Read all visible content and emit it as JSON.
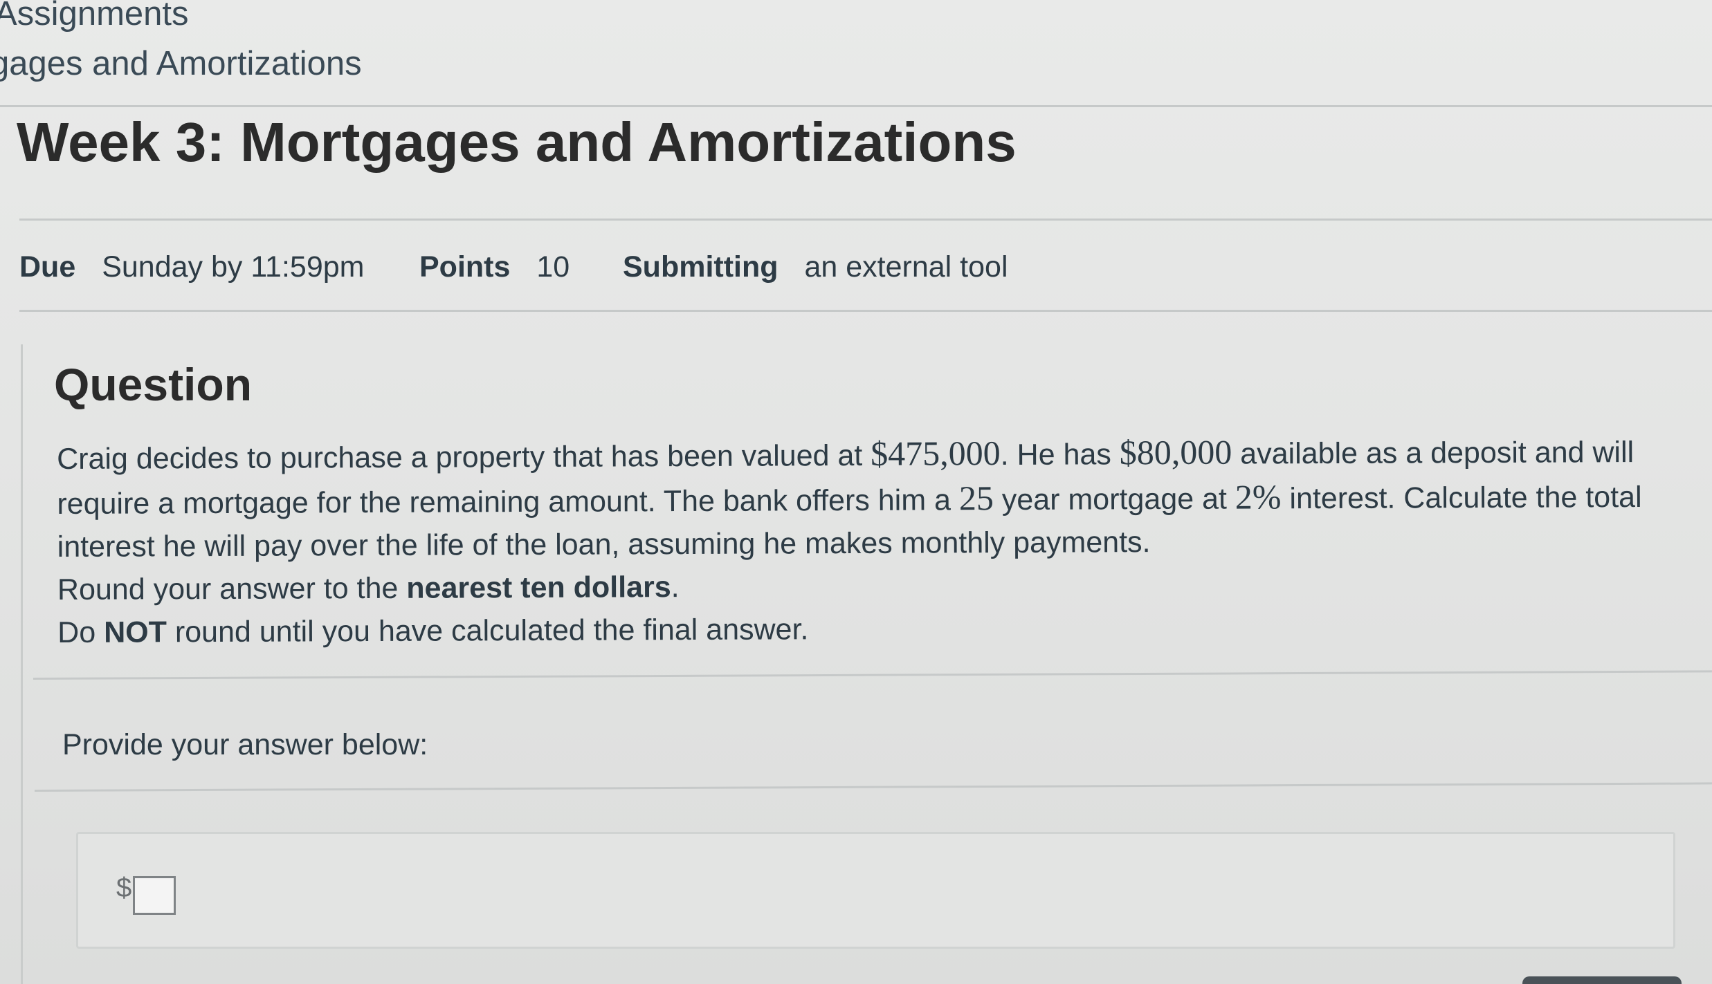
{
  "breadcrumbs": [
    "Assignments",
    "gages and Amortizations"
  ],
  "title": "Week 3: Mortgages and Amortizations",
  "details": {
    "due_label": "Due",
    "due_value": "Sunday by 11:59pm",
    "points_label": "Points",
    "points_value": "10",
    "submitting_label": "Submitting",
    "submitting_value": "an external tool"
  },
  "question": {
    "heading": "Question",
    "line1_a": "Craig decides to purchase a property that has been valued at ",
    "price": "$475,000",
    "line1_b": ". He has ",
    "deposit": "$80,000",
    "line1_c": " available as a deposit and will require a mortgage for the remaining amount. The bank offers him a ",
    "years": "25",
    "line1_d": " year mortgage at ",
    "rate": "2%",
    "line1_e": " interest. Calculate the total interest he will pay over the life of the loan, assuming he makes monthly payments.",
    "round_a": "Round your answer to the ",
    "round_bold": "nearest ten dollars",
    "round_b": ".",
    "donot_a": "Do ",
    "donot_bold": "NOT",
    "donot_b": " round until you have calculated the final answer."
  },
  "answer": {
    "prompt": "Provide your answer below:",
    "currency_symbol": "$",
    "value": ""
  }
}
